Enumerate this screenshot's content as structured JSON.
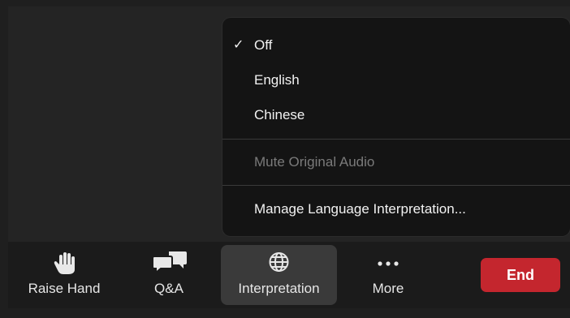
{
  "menu": {
    "check_mark": "✓",
    "items": [
      {
        "label": "Off",
        "checked": true
      },
      {
        "label": "English",
        "checked": false
      },
      {
        "label": "Chinese",
        "checked": false
      }
    ],
    "mute_original": "Mute Original Audio",
    "manage": "Manage Language Interpretation..."
  },
  "toolbar": {
    "raise_hand": "Raise Hand",
    "qa": "Q&A",
    "interpretation": "Interpretation",
    "more": "More",
    "end": "End"
  },
  "colors": {
    "end_button": "#c4262e",
    "menu_bg": "#141414",
    "active_tool_bg": "#3a3a3a"
  },
  "icons": {
    "raise_hand": "hand-icon",
    "qa": "chat-bubbles-icon",
    "interpretation": "globe-icon",
    "more": "ellipsis-icon"
  }
}
